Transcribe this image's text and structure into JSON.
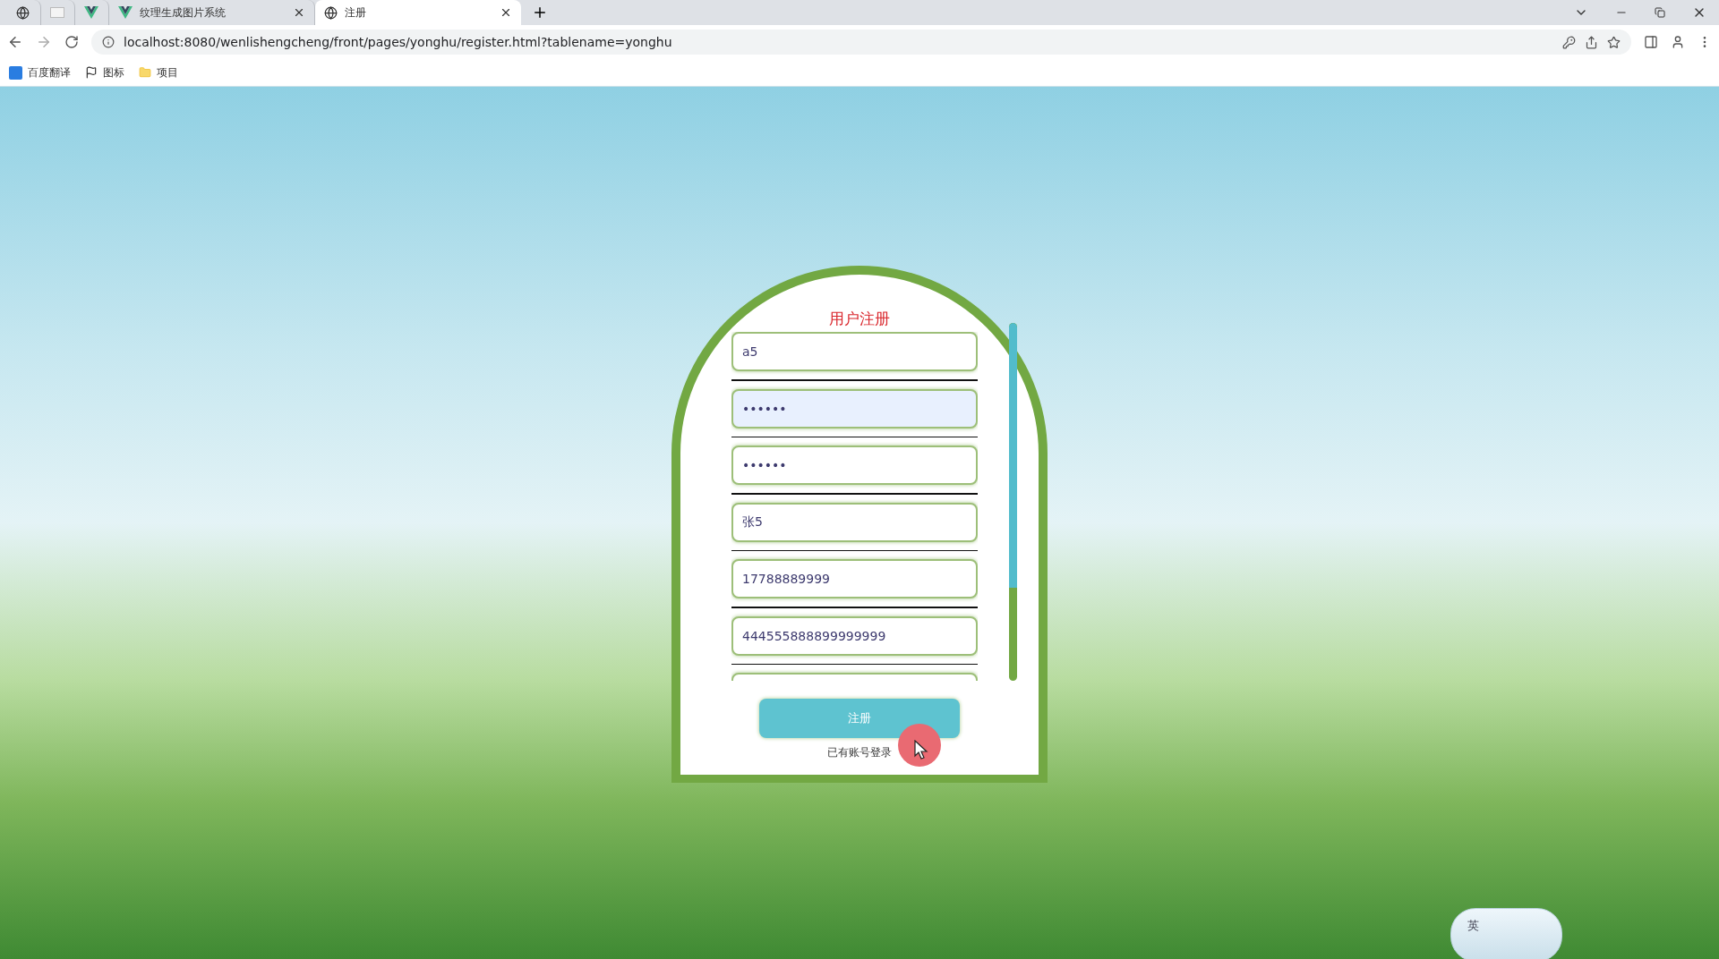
{
  "browser": {
    "tabs": [
      {
        "kind": "globe",
        "selected": false
      },
      {
        "kind": "blank",
        "selected": false
      },
      {
        "kind": "vue",
        "selected": false
      },
      {
        "kind": "vue",
        "label": "纹理生成图片系统",
        "selected": false
      },
      {
        "kind": "globe",
        "label": "注册",
        "selected": true
      }
    ],
    "address": "localhost:8080/wenlishengcheng/front/pages/yonghu/register.html?tablename=yonghu",
    "bookmarks": [
      {
        "kind": "translate",
        "label": "百度翻译"
      },
      {
        "kind": "flag",
        "label": "图标"
      },
      {
        "kind": "folder",
        "label": "项目"
      }
    ]
  },
  "form": {
    "title": "用户注册",
    "fields": [
      {
        "value": "a5",
        "autofilled": false
      },
      {
        "value": "••••••",
        "autofilled": true
      },
      {
        "value": "••••••",
        "autofilled": false
      },
      {
        "value": "张5",
        "autofilled": false
      },
      {
        "value": "17788889999",
        "autofilled": false
      },
      {
        "value": "444555888899999999",
        "autofilled": false
      },
      {
        "autofilled": false
      }
    ],
    "submit": "注册",
    "login_link": "已有账号登录"
  },
  "ime": {
    "label": "英"
  }
}
